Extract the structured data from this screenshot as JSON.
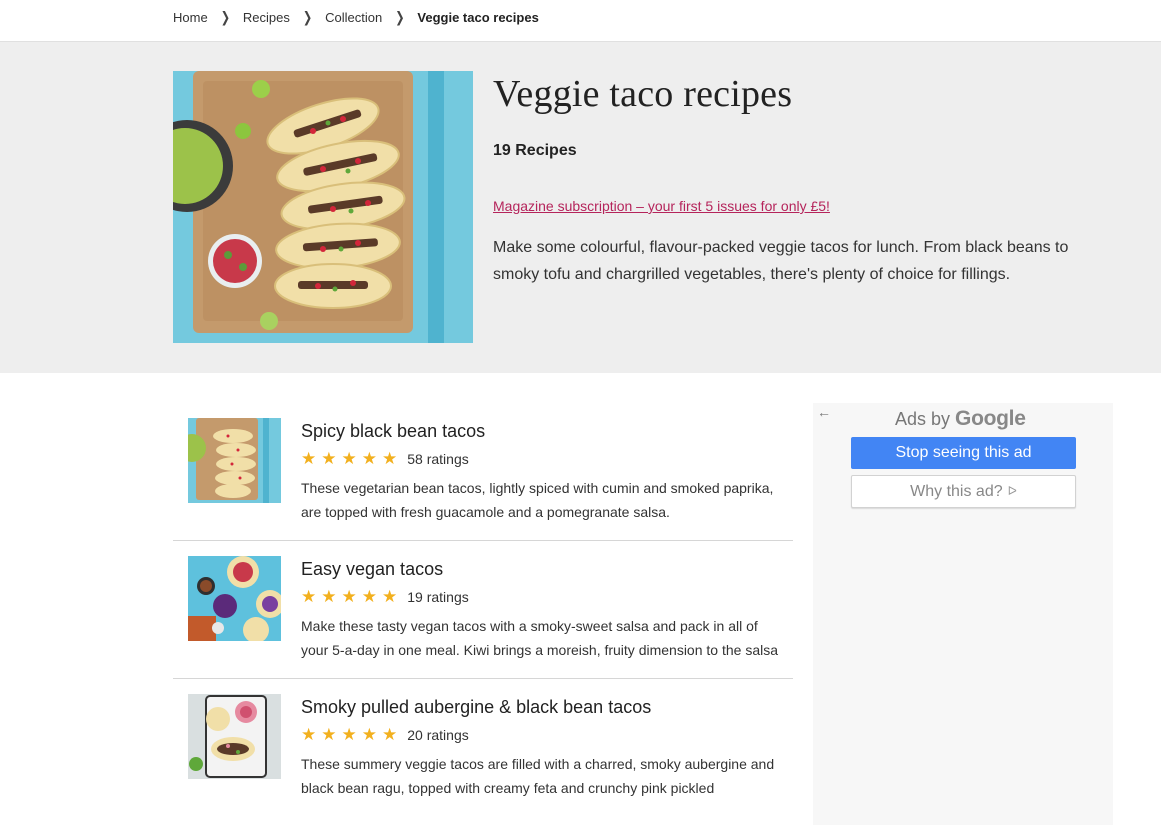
{
  "breadcrumb": {
    "items": [
      {
        "label": "Home"
      },
      {
        "label": "Recipes"
      },
      {
        "label": "Collection"
      }
    ],
    "current": "Veggie taco recipes",
    "separator": "❯"
  },
  "hero": {
    "title": "Veggie taco recipes",
    "recipe_count": "19 Recipes",
    "promo_link": "Magazine subscription – your first 5 issues for only £5!",
    "description": "Make some colourful, flavour-packed veggie tacos for lunch. From black beans to smoky tofu and chargrilled vegetables, there's plenty of choice for fillings."
  },
  "recipes": [
    {
      "title": "Spicy black bean tacos",
      "stars": 5,
      "ratings": "58 ratings",
      "description": "These vegetarian bean tacos, lightly spiced with cumin and smoked paprika, are topped with fresh guacamole and a pomegranate salsa."
    },
    {
      "title": "Easy vegan tacos",
      "stars": 5,
      "ratings": "19 ratings",
      "description": "Make these tasty vegan tacos with a smoky-sweet salsa and pack in all of your 5-a-day in one meal. Kiwi brings a moreish, fruity dimension to the salsa"
    },
    {
      "title": "Smoky pulled aubergine & black bean tacos",
      "stars": 5,
      "ratings": "20 ratings",
      "description": "These summery veggie tacos are filled with a charred, smoky aubergine and black bean ragu, topped with creamy feta and crunchy pink pickled"
    }
  ],
  "ad": {
    "back_icon": "←",
    "ads_by": "Ads by",
    "google": "Google",
    "stop_label": "Stop seeing this ad",
    "why_label": "Why this ad?",
    "why_icon": "ᐅ"
  },
  "colors": {
    "accent_link": "#b5245b",
    "star": "#f2b01e",
    "ad_button": "#4285f4",
    "hero_bg": "#eeeeee"
  }
}
